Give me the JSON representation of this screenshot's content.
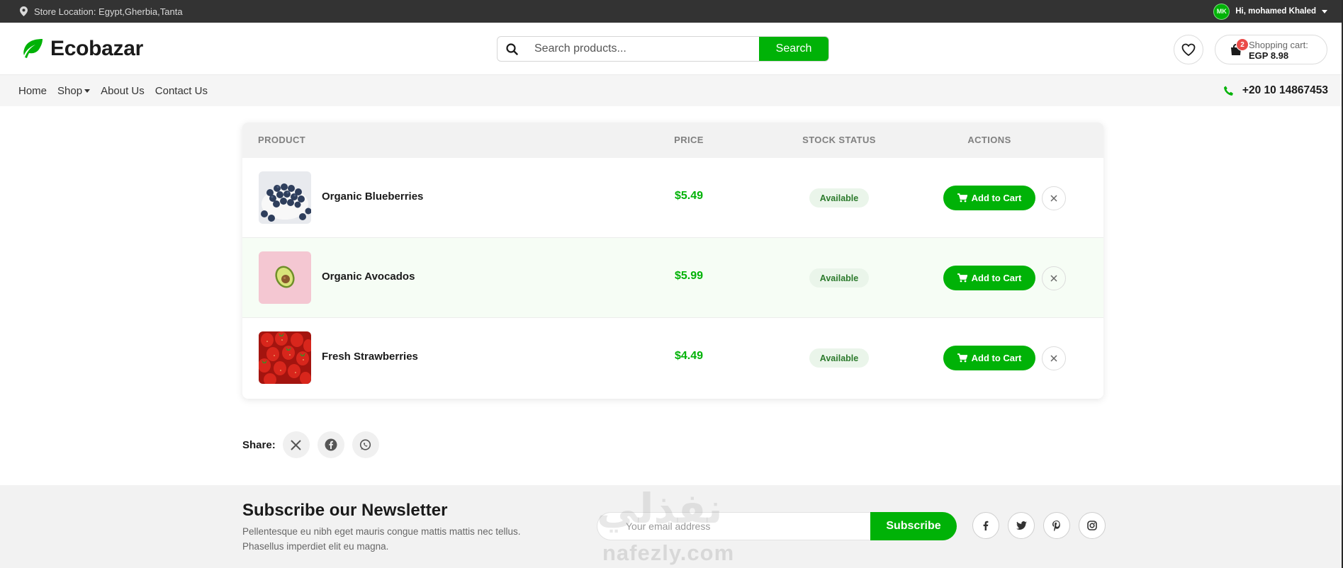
{
  "topbar": {
    "location": "Store Location: Egypt,Gherbia,Tanta",
    "avatar_initials": "MK",
    "greeting": "Hi, mohamed Khaled"
  },
  "header": {
    "logo": "Ecobazar",
    "search_placeholder": "Search products...",
    "search_button": "Search",
    "cart_count": "2",
    "cart_label": "Shopping cart:",
    "cart_total": "EGP 8.98"
  },
  "nav": {
    "items": [
      "Home",
      "Shop",
      "About Us",
      "Contact Us"
    ],
    "phone": "+20 10 14867453"
  },
  "table": {
    "headers": {
      "product": "PRODUCT",
      "price": "PRICE",
      "stock": "STOCK STATUS",
      "actions": "ACTIONS"
    },
    "rows": [
      {
        "name": "Organic Blueberries",
        "price": "$5.49",
        "stock": "Available",
        "add_label": "Add to Cart"
      },
      {
        "name": "Organic Avocados",
        "price": "$5.99",
        "stock": "Available",
        "add_label": "Add to Cart"
      },
      {
        "name": "Fresh Strawberries",
        "price": "$4.49",
        "stock": "Available",
        "add_label": "Add to Cart"
      }
    ]
  },
  "share": {
    "label": "Share:"
  },
  "newsletter": {
    "title": "Subscribe our Newsletter",
    "text": "Pellentesque eu nibh eget mauris congue mattis mattis nec tellus. Phasellus imperdiet elit eu magna.",
    "placeholder": "Your email address",
    "button": "Subscribe"
  },
  "watermark": {
    "arabic": "نفذلي",
    "latin": "nafezly.com"
  },
  "colors": {
    "accent": "#00b207",
    "topbar": "#333333",
    "badge": "#ea4b48"
  },
  "icons": [
    "location-pin-icon",
    "search-icon",
    "leaf-logo-icon",
    "heart-icon",
    "shopping-bag-icon",
    "caret-down-icon",
    "phone-icon",
    "cart-icon",
    "close-icon",
    "x-twitter-icon",
    "facebook-icon",
    "whatsapp-icon",
    "twitter-icon",
    "pinterest-icon",
    "instagram-icon"
  ]
}
